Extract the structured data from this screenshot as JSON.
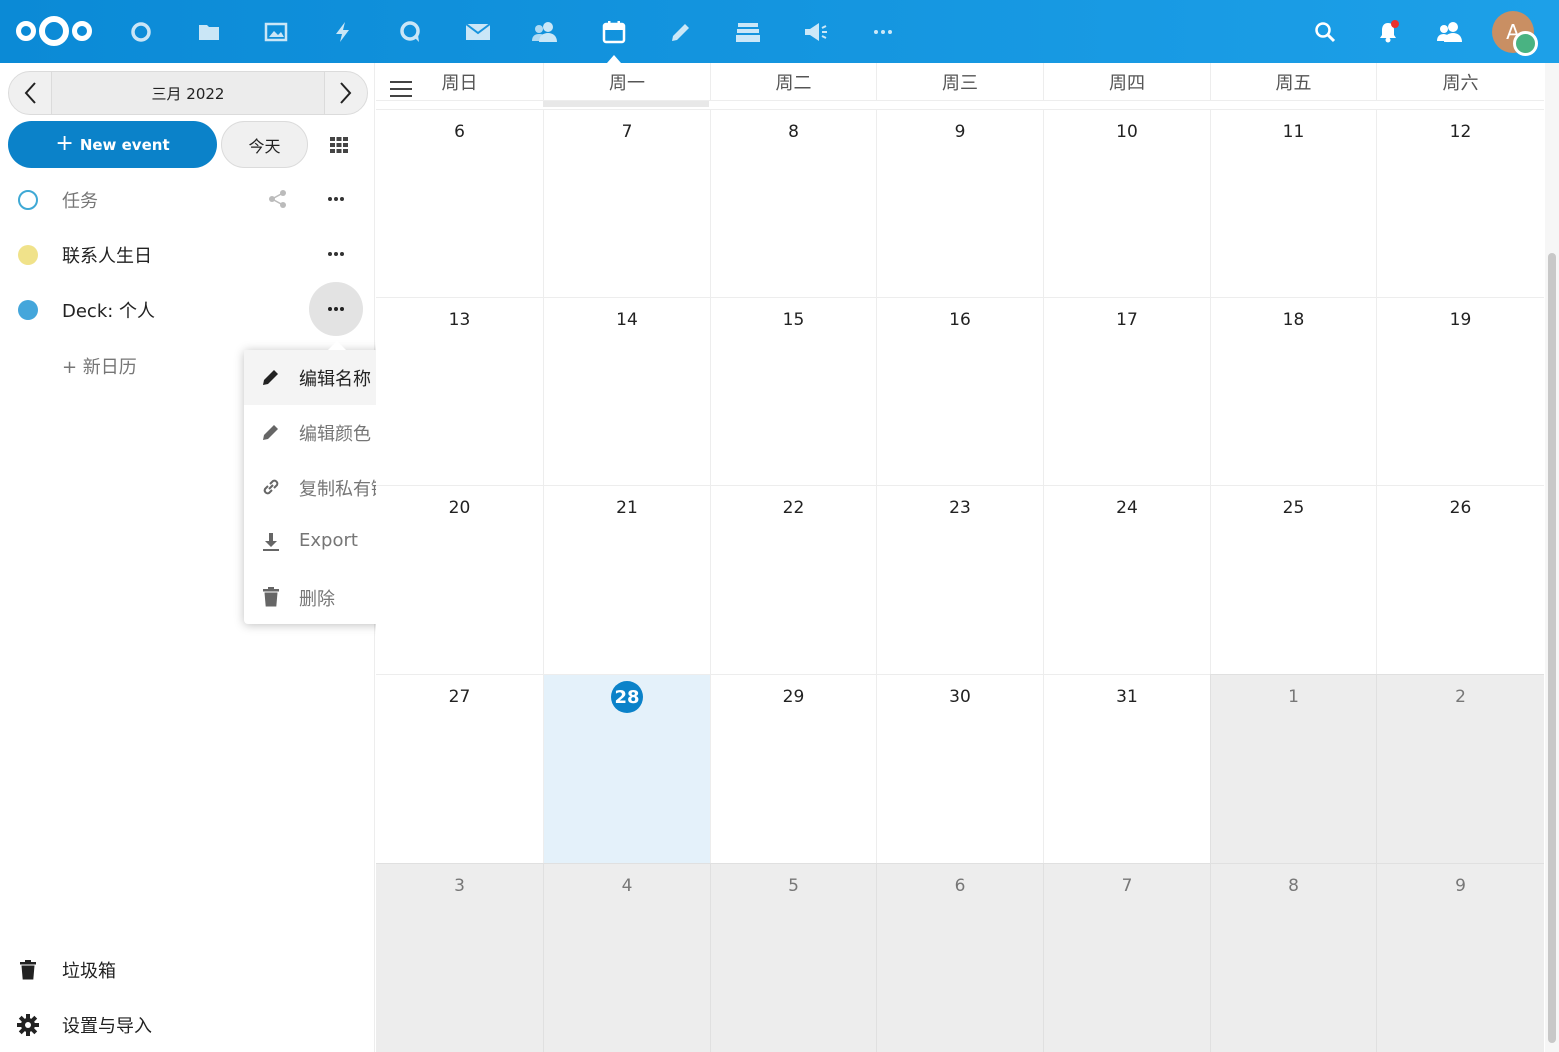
{
  "header": {
    "logo_name": "nextcloud-logo",
    "apps": [
      {
        "name": "dashboard",
        "icon": "circle-icon"
      },
      {
        "name": "files",
        "icon": "folder-icon"
      },
      {
        "name": "photos",
        "icon": "image-icon"
      },
      {
        "name": "activity",
        "icon": "lightning-icon"
      },
      {
        "name": "talk",
        "icon": "chat-bubble-icon"
      },
      {
        "name": "mail",
        "icon": "envelope-icon"
      },
      {
        "name": "contacts",
        "icon": "contacts-icon"
      },
      {
        "name": "calendar",
        "icon": "calendar-icon",
        "active": true
      },
      {
        "name": "notes",
        "icon": "pencil-icon"
      },
      {
        "name": "deck",
        "icon": "stack-icon"
      },
      {
        "name": "announcements",
        "icon": "megaphone-icon"
      },
      {
        "name": "more-apps",
        "icon": "ellipsis-icon"
      }
    ],
    "avatar_initial": "A",
    "accent_color": "#1a96df",
    "notification_dot_color": "#e9322d"
  },
  "sidebar": {
    "month_label": "三月 2022",
    "new_event_label": "New event",
    "today_label": "今天",
    "calendars": [
      {
        "label": "任务",
        "color": "#3fa9d5",
        "style": "ring"
      },
      {
        "label": "联系人生日",
        "color": "#f0e28a",
        "style": "filled"
      },
      {
        "label": "Deck: 个人",
        "color": "#44a6db",
        "style": "filled"
      }
    ],
    "new_calendar_label": "+ 新日历",
    "trash_label": "垃圾箱",
    "settings_label": "设置与导入"
  },
  "popover": {
    "items": [
      {
        "label": "编辑名称",
        "icon": "pencil-icon",
        "highlighted": true
      },
      {
        "label": "编辑颜色",
        "icon": "pencil-icon"
      },
      {
        "label": "复制私有链接",
        "icon": "link-icon"
      },
      {
        "label": "Export",
        "icon": "download-icon"
      },
      {
        "label": "删除",
        "icon": "trash-icon"
      }
    ]
  },
  "calendar": {
    "weekdays": [
      "周日",
      "周一",
      "周二",
      "周三",
      "周四",
      "周五",
      "周六"
    ],
    "today": "28",
    "today_color": "#0b82c9",
    "weeks": [
      [
        {
          "d": "6"
        },
        {
          "d": "7"
        },
        {
          "d": "8"
        },
        {
          "d": "9"
        },
        {
          "d": "10"
        },
        {
          "d": "11"
        },
        {
          "d": "12"
        }
      ],
      [
        {
          "d": "13"
        },
        {
          "d": "14"
        },
        {
          "d": "15"
        },
        {
          "d": "16"
        },
        {
          "d": "17"
        },
        {
          "d": "18"
        },
        {
          "d": "19"
        }
      ],
      [
        {
          "d": "20"
        },
        {
          "d": "21"
        },
        {
          "d": "22"
        },
        {
          "d": "23"
        },
        {
          "d": "24"
        },
        {
          "d": "25"
        },
        {
          "d": "26"
        }
      ],
      [
        {
          "d": "27"
        },
        {
          "d": "28",
          "today": true
        },
        {
          "d": "29"
        },
        {
          "d": "30"
        },
        {
          "d": "31"
        },
        {
          "d": "1",
          "other": true
        },
        {
          "d": "2",
          "other": true
        }
      ],
      [
        {
          "d": "3",
          "other": true
        },
        {
          "d": "4",
          "other": true
        },
        {
          "d": "5",
          "other": true
        },
        {
          "d": "6",
          "other": true
        },
        {
          "d": "7",
          "other": true
        },
        {
          "d": "8",
          "other": true
        },
        {
          "d": "9",
          "other": true
        }
      ]
    ]
  }
}
